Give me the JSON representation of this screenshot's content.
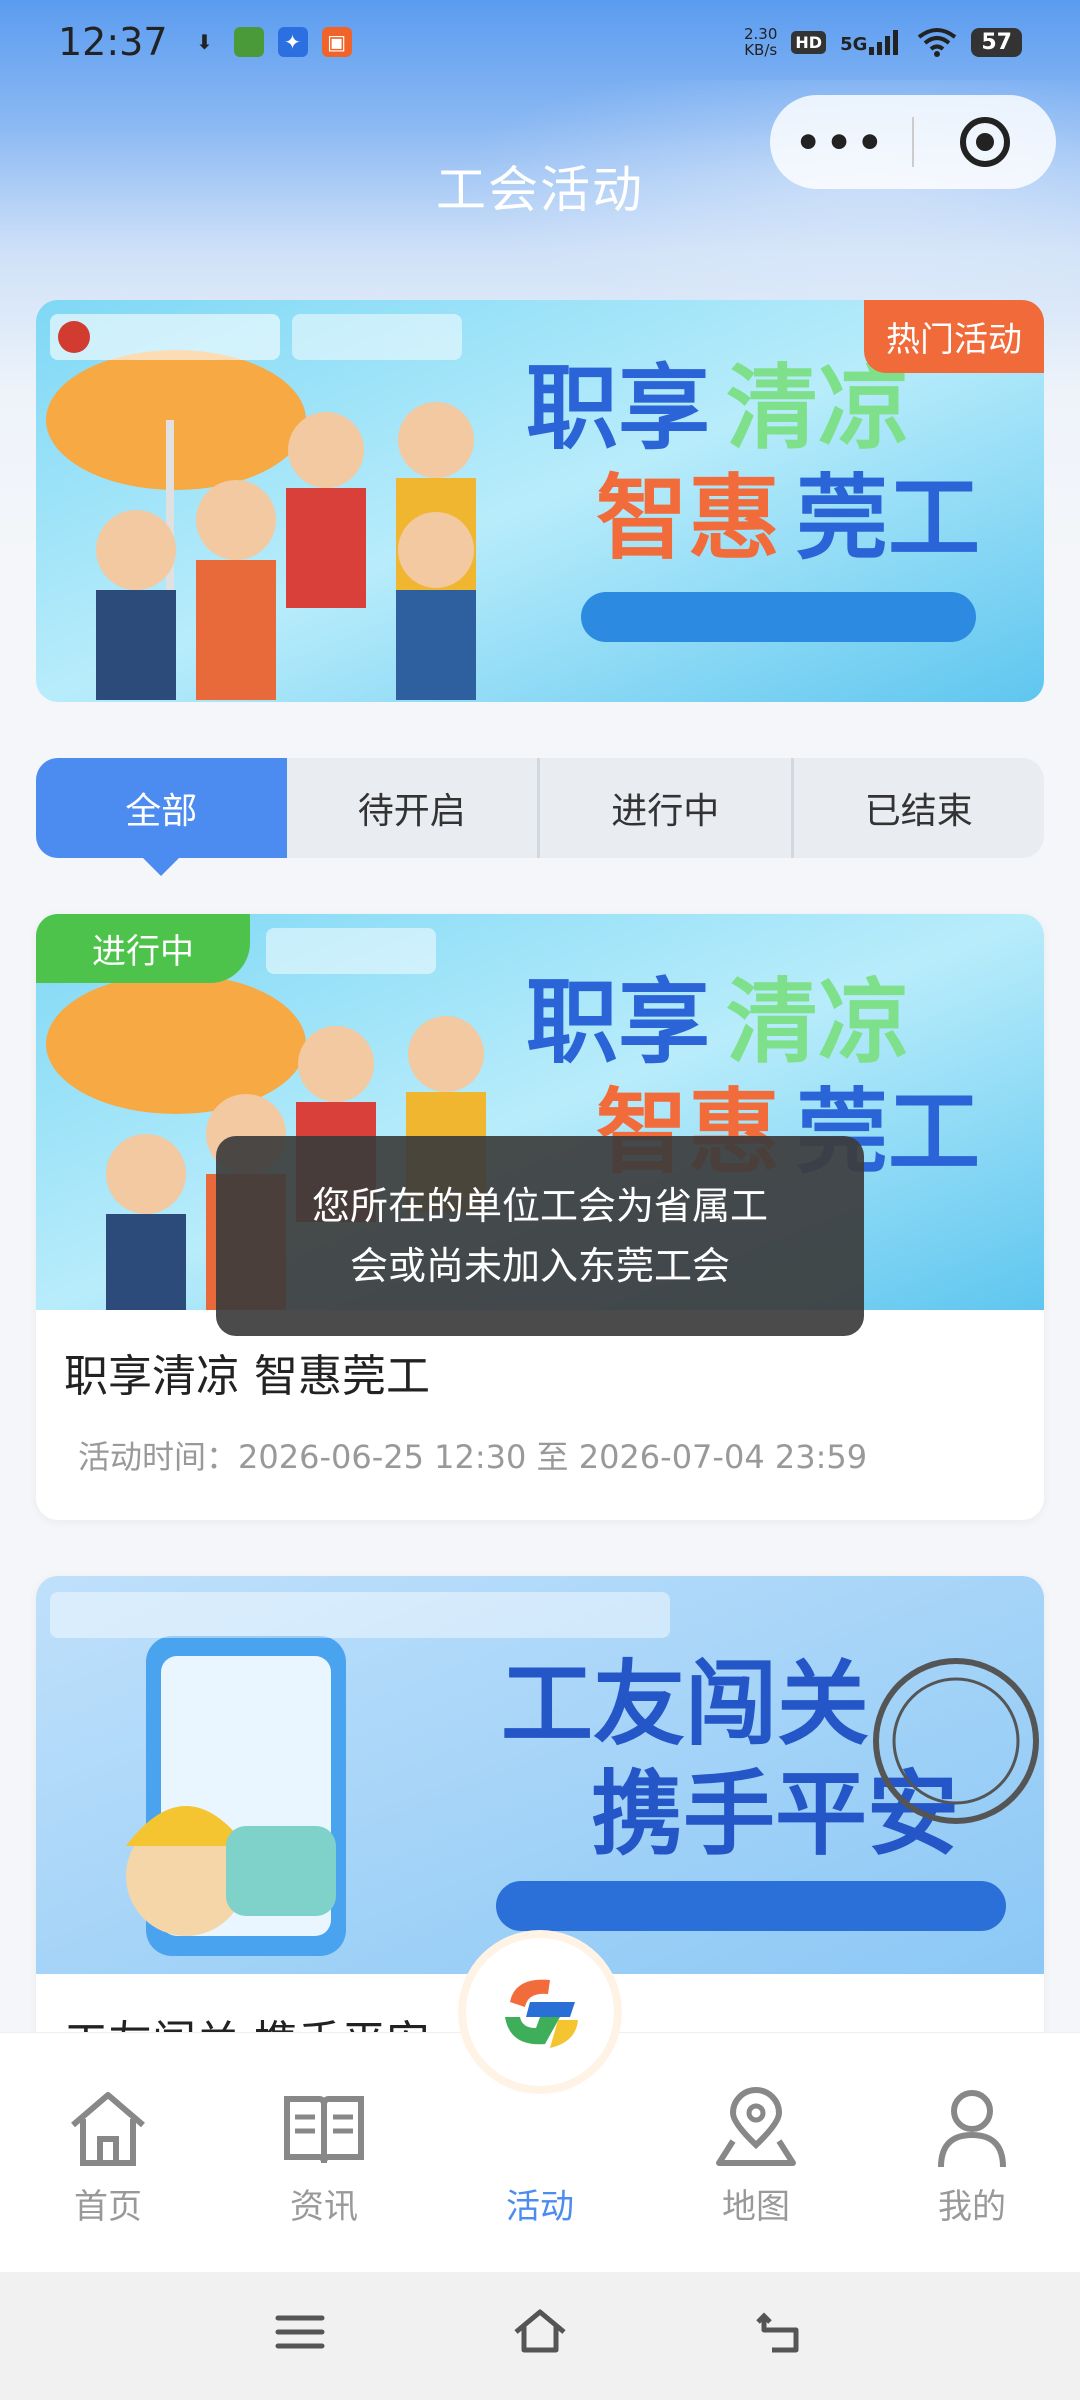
{
  "status_bar": {
    "time": "12:37",
    "net_speed_value": "2.30",
    "net_speed_unit": "KB/s",
    "hd": "HD",
    "signal": "5G",
    "battery": "57"
  },
  "header": {
    "title": "工会活动"
  },
  "hot_banner": {
    "tag": "热门活动"
  },
  "tabs": [
    {
      "label": "全部",
      "active": true
    },
    {
      "label": "待开启",
      "active": false
    },
    {
      "label": "进行中",
      "active": false
    },
    {
      "label": "已结束",
      "active": false
    }
  ],
  "activities": [
    {
      "status": "进行中",
      "title": "职享清凉 智惠莞工",
      "time": "活动时间：2026-06-25 12:30 至 2026-07-04 23:59"
    },
    {
      "title": "工友闯关 携手平安"
    }
  ],
  "toast": {
    "line1": "您所在的单位工会为省属工",
    "line2": "会或尚未加入东莞工会"
  },
  "bottom_nav": [
    {
      "label": "首页",
      "icon": "home-icon"
    },
    {
      "label": "资讯",
      "icon": "book-icon"
    },
    {
      "label": "活动",
      "icon": "activity-icon",
      "active": true
    },
    {
      "label": "地图",
      "icon": "map-pin-icon"
    },
    {
      "label": "我的",
      "icon": "user-icon"
    }
  ],
  "colors": {
    "accent": "#4c8cf0",
    "hot_tag": "#f06a3a",
    "status_ongoing": "#4ec34c"
  }
}
